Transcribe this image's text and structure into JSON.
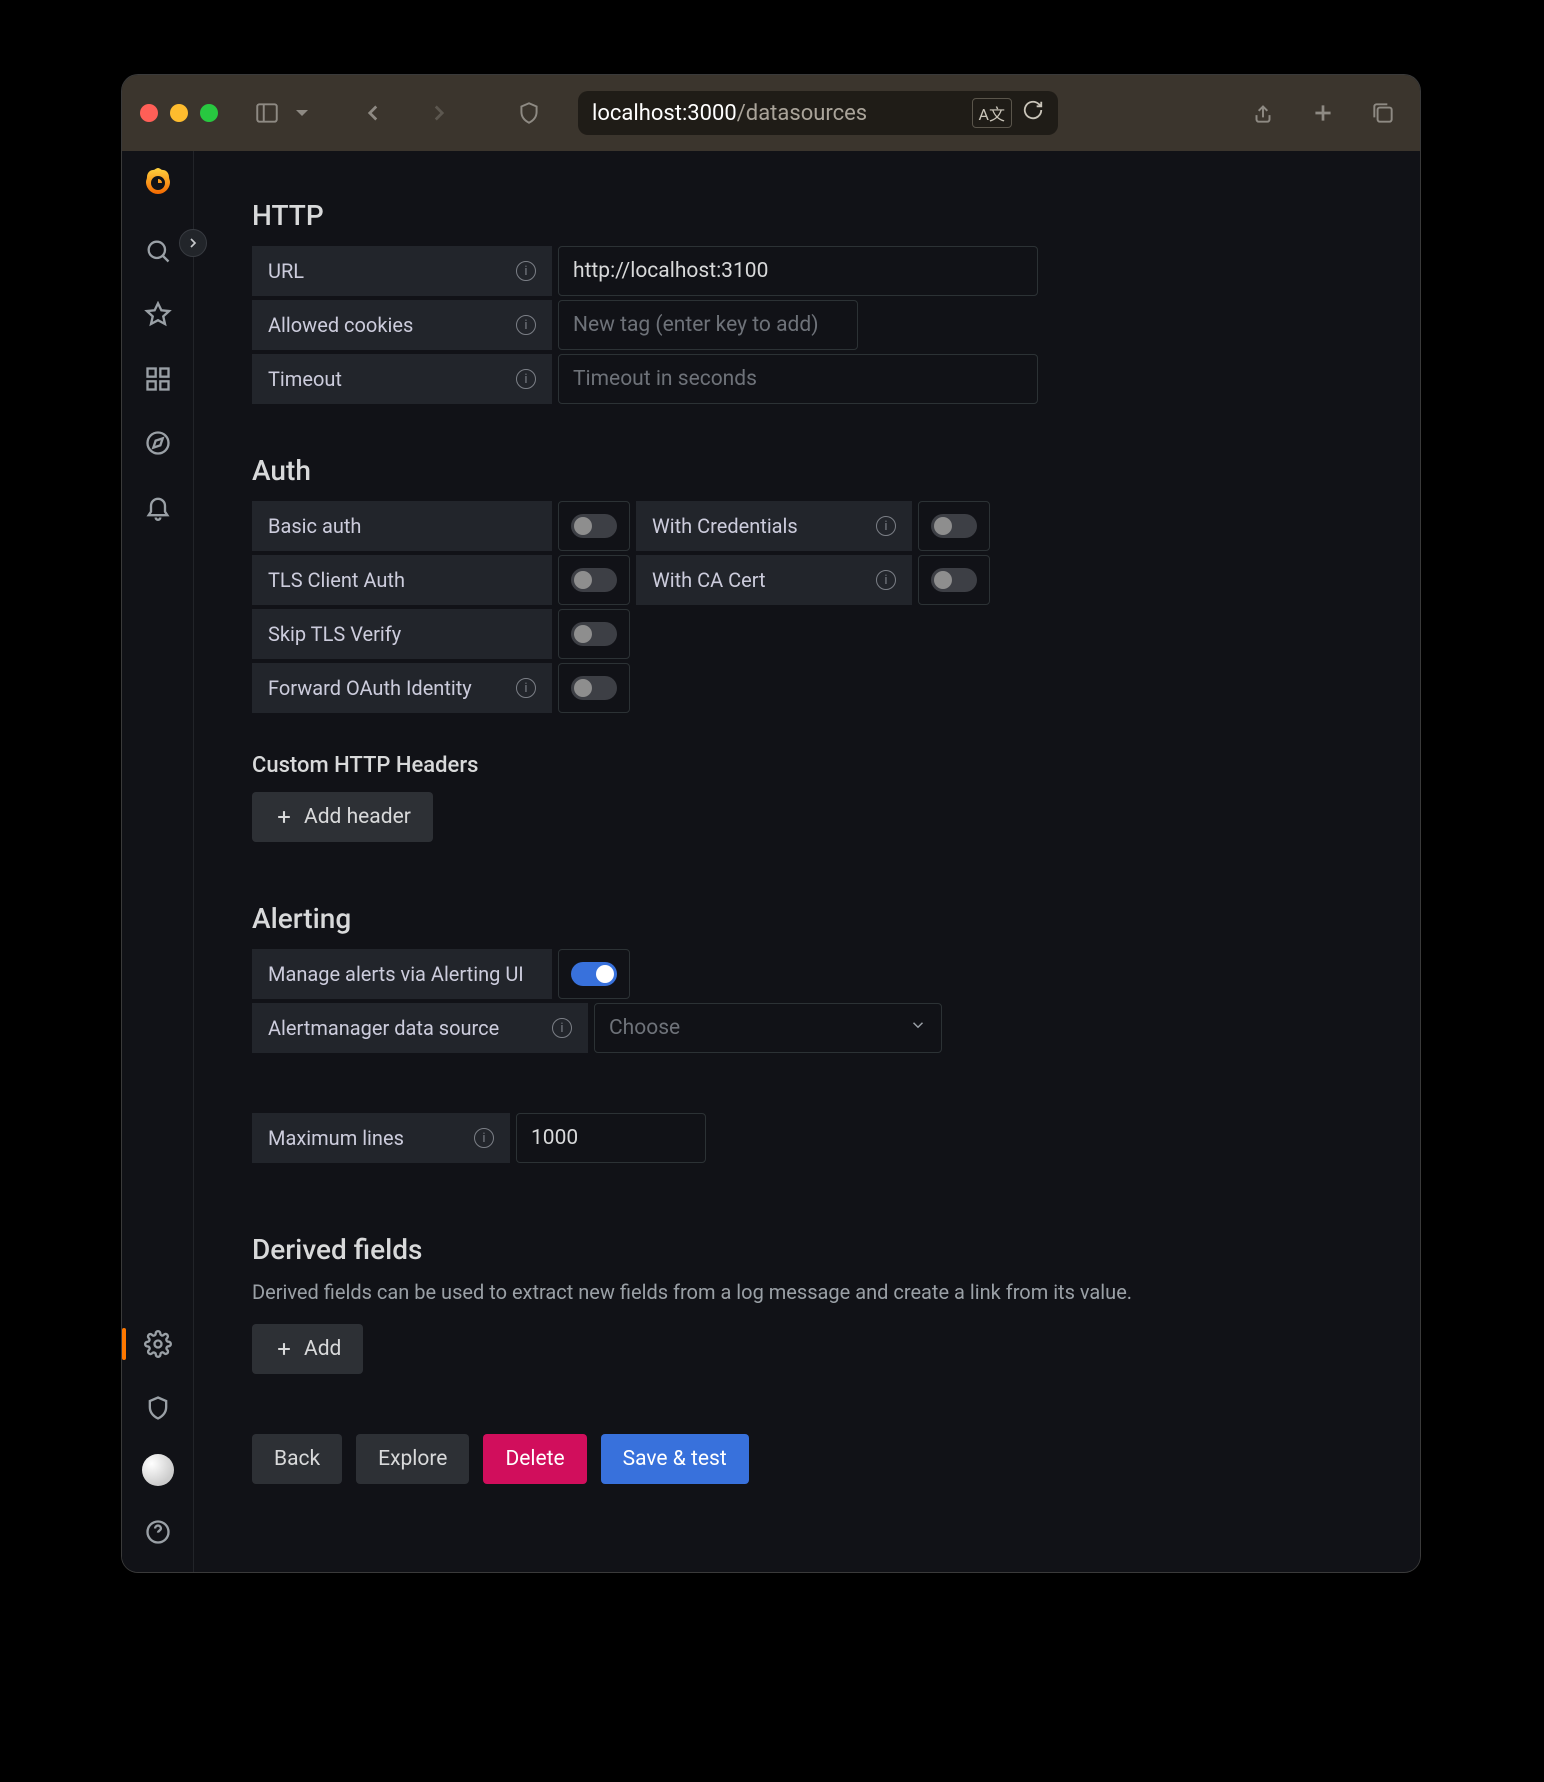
{
  "browser": {
    "url_host": "localhost:3000",
    "url_path": "/datasources"
  },
  "http": {
    "title": "HTTP",
    "url_label": "URL",
    "url_value": "http://localhost:3100",
    "cookies_label": "Allowed cookies",
    "cookies_placeholder": "New tag (enter key to add)",
    "timeout_label": "Timeout",
    "timeout_placeholder": "Timeout in seconds"
  },
  "auth": {
    "title": "Auth",
    "basic_label": "Basic auth",
    "creds_label": "With Credentials",
    "tls_client_label": "TLS Client Auth",
    "ca_cert_label": "With CA Cert",
    "skip_tls_label": "Skip TLS Verify",
    "forward_oauth_label": "Forward OAuth Identity"
  },
  "custom_headers": {
    "title": "Custom HTTP Headers",
    "add_label": "Add header"
  },
  "alerting": {
    "title": "Alerting",
    "manage_label": "Manage alerts via Alerting UI",
    "manage_on": true,
    "am_label": "Alertmanager data source",
    "am_placeholder": "Choose"
  },
  "max_lines": {
    "label": "Maximum lines",
    "value": "1000"
  },
  "derived": {
    "title": "Derived fields",
    "desc": "Derived fields can be used to extract new fields from a log message and create a link from its value.",
    "add_label": "Add"
  },
  "footer": {
    "back": "Back",
    "explore": "Explore",
    "delete": "Delete",
    "save": "Save & test"
  }
}
